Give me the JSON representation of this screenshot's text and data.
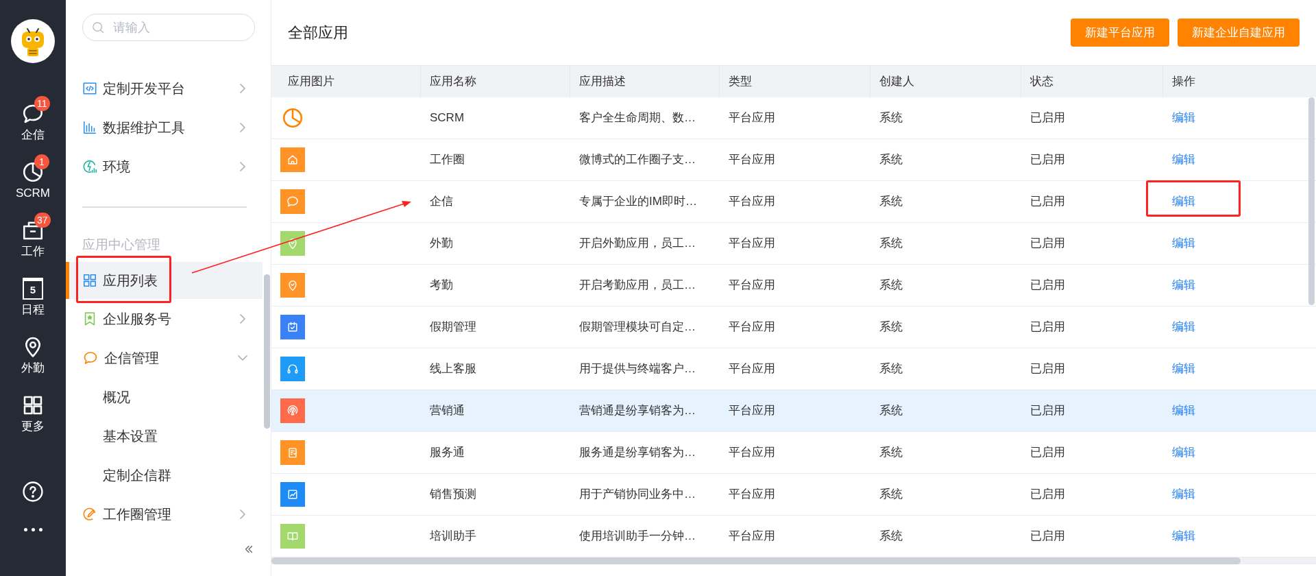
{
  "rail": {
    "items": [
      {
        "kind": "chat",
        "label": "企信",
        "badge": "11"
      },
      {
        "kind": "pie",
        "label": "SCRM",
        "badge": "1"
      },
      {
        "kind": "briefcase",
        "label": "工作",
        "badge": "37"
      },
      {
        "kind": "calendar",
        "label": "日程",
        "day": "5"
      },
      {
        "kind": "pin",
        "label": "外勤"
      },
      {
        "kind": "grid",
        "label": "更多"
      }
    ]
  },
  "sidebar": {
    "search": {
      "placeholder": "请输入"
    },
    "top_items": [
      {
        "label": "定制开发平台",
        "kind": "group",
        "expanded": false,
        "selected": false
      },
      {
        "label": "数据维护工具",
        "kind": "group",
        "expanded": false,
        "selected": false
      },
      {
        "label": "环境",
        "kind": "group",
        "expanded": false,
        "selected": false
      }
    ],
    "section_title": "应用中心管理",
    "items": [
      {
        "label": "应用列表",
        "kind": "page",
        "selected": true
      },
      {
        "label": "企业服务号",
        "kind": "group",
        "expanded": false,
        "selected": false
      },
      {
        "label": "企信管理",
        "kind": "group",
        "expanded": true,
        "selected": false,
        "children": [
          {
            "label": "概况",
            "selected": false
          },
          {
            "label": "基本设置",
            "selected": false
          },
          {
            "label": "定制企信群",
            "selected": false
          }
        ]
      },
      {
        "label": "工作圈管理",
        "kind": "group",
        "expanded": false,
        "selected": false
      }
    ]
  },
  "main": {
    "title": "全部应用",
    "buttons": [
      "新建平台应用",
      "新建企业自建应用"
    ],
    "table": {
      "columns": [
        "应用图片",
        "应用名称",
        "应用描述",
        "类型",
        "创建人",
        "状态",
        "操作"
      ],
      "rows": [
        {
          "kind": "outline",
          "color": "#ff8200",
          "name": "SCRM",
          "description": "客户全生命周期、数…",
          "type": "平台应用",
          "creator": "系统",
          "status": "已启用",
          "action": "编辑",
          "selected": false
        },
        {
          "kind": "tile",
          "color": "#ff9326",
          "name": "工作圈",
          "description": "微博式的工作圈子支…",
          "type": "平台应用",
          "creator": "系统",
          "status": "已启用",
          "action": "编辑",
          "selected": false
        },
        {
          "kind": "tile",
          "color": "#ff9326",
          "name": "企信",
          "description": "专属于企业的IM即时…",
          "type": "平台应用",
          "creator": "系统",
          "status": "已启用",
          "action": "编辑",
          "selected": false
        },
        {
          "kind": "tile",
          "color": "#a3d86c",
          "name": "外勤",
          "description": "开启外勤应用，员工…",
          "type": "平台应用",
          "creator": "系统",
          "status": "已启用",
          "action": "编辑",
          "selected": false
        },
        {
          "kind": "tile",
          "color": "#ff9326",
          "name": "考勤",
          "description": "开启考勤应用，员工…",
          "type": "平台应用",
          "creator": "系统",
          "status": "已启用",
          "action": "编辑",
          "selected": false
        },
        {
          "kind": "tile",
          "color": "#3a80f6",
          "name": "假期管理",
          "description": "假期管理模块可自定…",
          "type": "平台应用",
          "creator": "系统",
          "status": "已启用",
          "action": "编辑",
          "selected": false
        },
        {
          "kind": "tile",
          "color": "#1e9bf6",
          "name": "线上客服",
          "description": "用于提供与终端客户…",
          "type": "平台应用",
          "creator": "系统",
          "status": "已启用",
          "action": "编辑",
          "selected": false
        },
        {
          "kind": "tile",
          "color": "#ff6b4a",
          "name": "营销通",
          "description": "营销通是纷享销客为…",
          "type": "平台应用",
          "creator": "系统",
          "status": "已启用",
          "action": "编辑",
          "selected": true
        },
        {
          "kind": "tile",
          "color": "#ff9326",
          "name": "服务通",
          "description": "服务通是纷享销客为…",
          "type": "平台应用",
          "creator": "系统",
          "status": "已启用",
          "action": "编辑",
          "selected": false
        },
        {
          "kind": "tile",
          "color": "#1e8cf6",
          "name": "销售预测",
          "description": "用于产销协同业务中…",
          "type": "平台应用",
          "creator": "系统",
          "status": "已启用",
          "action": "编辑",
          "selected": false
        },
        {
          "kind": "tile",
          "color": "#a3d86c",
          "name": "培训助手",
          "description": "使用培训助手一分钟…",
          "type": "平台应用",
          "creator": "系统",
          "status": "已启用",
          "action": "编辑",
          "selected": false
        }
      ]
    }
  }
}
